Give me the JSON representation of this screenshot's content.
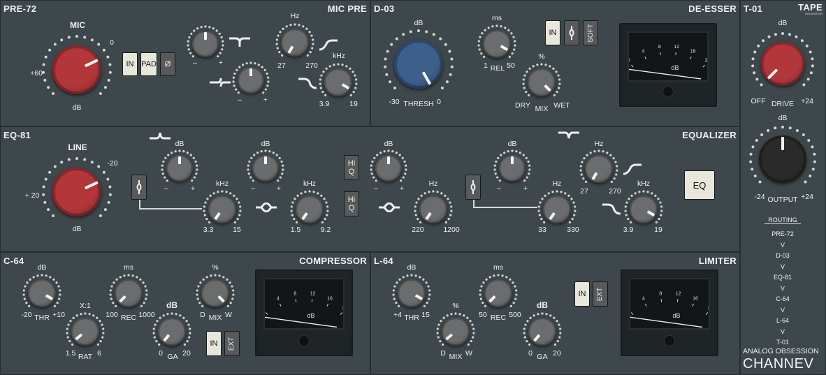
{
  "plugin": {
    "brand_line": "ANALOG OBSESSION",
    "product": "CHANNEV"
  },
  "pre72": {
    "title": "PRE-72",
    "section": "MIC PRE",
    "mic_label": "MIC",
    "mic_min": "+60",
    "mic_max": "0",
    "mic_unit": "dB",
    "in_label": "IN",
    "pad_label": "PAD",
    "phase_label": "Ø",
    "lowcut_min": "–",
    "lowcut_max": "+",
    "freq1_unit": "Hz",
    "freq1_min": "27",
    "freq1_max": "270",
    "shelf_min": "–",
    "shelf_max": "+",
    "freq2_unit": "kHz",
    "freq2_min": "3.9",
    "freq2_max": "19"
  },
  "d03": {
    "title": "D-03",
    "section": "DE-ESSER",
    "thresh_unit": "dB",
    "thresh_label": "THRESH",
    "thresh_min": "-30",
    "thresh_max": "0",
    "rel_unit": "ms",
    "rel_label": "REL",
    "rel_min": "1",
    "rel_max": "50",
    "mix_unit": "%",
    "mix_label": "MIX",
    "mix_min": "DRY",
    "mix_max": "WET",
    "in_label": "IN",
    "soft_label": "SOFT",
    "meter_unit": "dB",
    "meter_ticks": [
      "0",
      "4",
      "8",
      "12",
      "16",
      "20"
    ]
  },
  "t01": {
    "title": "T-01",
    "section": "TAPE",
    "section_sub": "SATURATION",
    "drive_unit": "dB",
    "drive_label": "DRIVE",
    "drive_min": "OFF",
    "drive_max": "+24",
    "out_unit": "dB",
    "out_label": "OUTPUT",
    "out_min": "-24",
    "out_max": "+24",
    "routing_title": "ROUTING",
    "routing": [
      "PRE-72",
      "V",
      "D-03",
      "V",
      "EQ-81",
      "V",
      "C-64",
      "V",
      "L-64",
      "V",
      "T-01"
    ]
  },
  "eq81": {
    "title": "EQ-81",
    "section": "EQUALIZER",
    "line_label": "LINE",
    "line_min": "+ 20",
    "line_max": "-20",
    "line_unit": "dB",
    "b1_unit": "dB",
    "b1_min": "–",
    "b1_max": "+",
    "b1f_unit": "kHz",
    "b1f_min": "3.3",
    "b1f_max": "15",
    "b2_unit": "dB",
    "b2_min": "–",
    "b2_max": "+",
    "b2f_unit": "kHz",
    "b2f_min": "1.5",
    "b2f_max": "9.2",
    "hiq_label1": "Hi",
    "hiq_label2": "Q",
    "b3_unit": "dB",
    "b3_min": "–",
    "b3_max": "+",
    "b3f_unit": "Hz",
    "b3f_min": "220",
    "b3f_max": "1200",
    "b4_unit": "dB",
    "b4_min": "–",
    "b4_max": "+",
    "b4f_unit": "Hz",
    "b4f_min": "33",
    "b4f_max": "330",
    "hp_unit": "Hz",
    "hp_min": "27",
    "hp_max": "270",
    "lp_unit": "kHz",
    "lp_min": "3.9",
    "lp_max": "19",
    "eq_button": "EQ"
  },
  "c64": {
    "title": "C-64",
    "section": "COMPRESSOR",
    "thr_unit": "dB",
    "thr_label": "THR",
    "thr_min": "-20",
    "thr_max": "+10",
    "rat_unit": "X:1",
    "rat_label": "RAT",
    "rat_min": "1.5",
    "rat_max": "6",
    "rec_unit": "ms",
    "rec_label": "REC",
    "rec_min": "100",
    "rec_max": "1000",
    "ga_unit": "dB",
    "ga_label": "GA",
    "ga_min": "0",
    "ga_max": "20",
    "mix_unit": "%",
    "mix_label": "MIX",
    "mix_min": "D",
    "mix_max": "W",
    "in_label": "IN",
    "ext_label": "EXT",
    "meter_unit": "dB",
    "meter_ticks": [
      "0",
      "4",
      "8",
      "12",
      "16",
      "20"
    ]
  },
  "l64": {
    "title": "L-64",
    "section": "LIMITER",
    "thr_unit": "dB",
    "thr_label": "THR",
    "thr_min": "+4",
    "thr_max": "15",
    "rec_unit": "ms",
    "rec_label": "REC",
    "rec_min": "50",
    "rec_max": "500",
    "mix_unit": "%",
    "mix_label": "MIX",
    "mix_min": "D",
    "mix_max": "W",
    "ga_unit": "dB",
    "ga_label": "GA",
    "ga_min": "0",
    "ga_max": "20",
    "in_label": "IN",
    "ext_label": "EXT",
    "meter_unit": "dB",
    "meter_ticks": [
      "0",
      "4",
      "8",
      "12",
      "16",
      "20"
    ]
  },
  "colors": {
    "red_knob": "#b3363b",
    "blue_knob": "#3e5e8c",
    "gray_knob": "#6a6c6d",
    "black_knob": "#2a2a2a",
    "panel": "#3e484c"
  }
}
